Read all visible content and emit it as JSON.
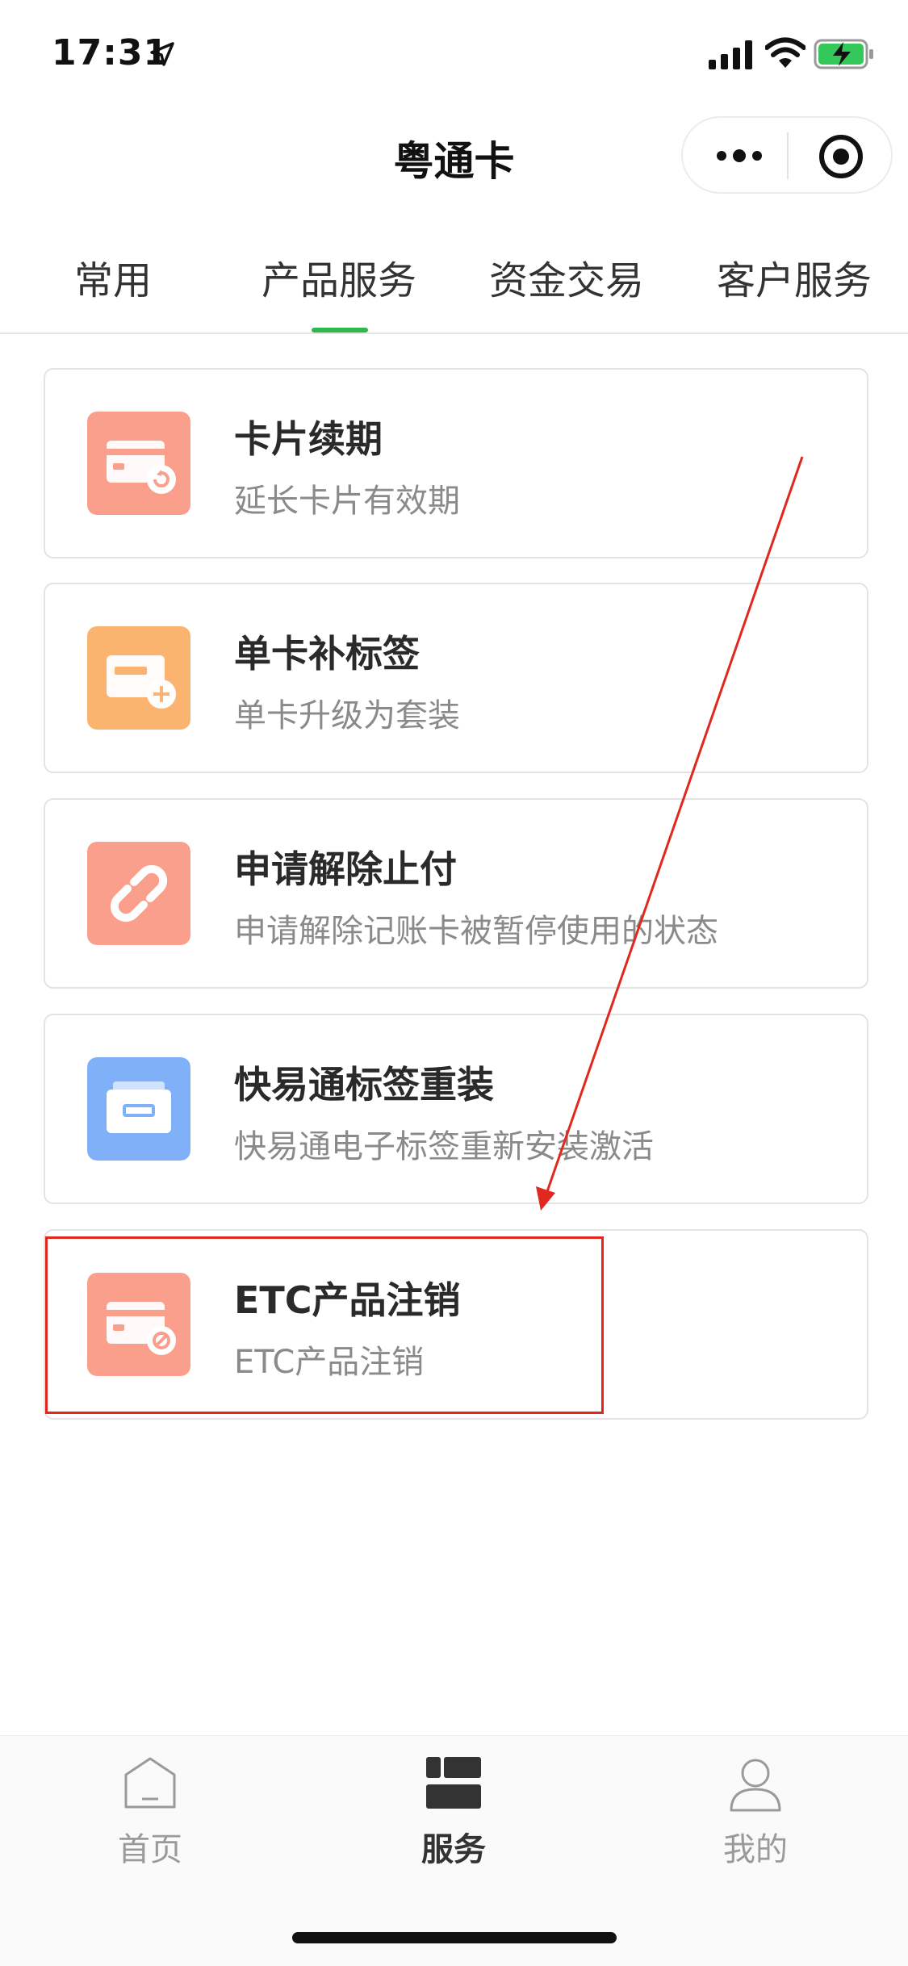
{
  "status_bar": {
    "time": "17:31"
  },
  "nav": {
    "title": "粤通卡"
  },
  "tabs": [
    {
      "label": "常用"
    },
    {
      "label": "产品服务"
    },
    {
      "label": "资金交易"
    },
    {
      "label": "客户服务"
    }
  ],
  "cards": [
    {
      "title": "卡片续期",
      "subtitle": "延长卡片有效期",
      "icon": "card-renew-icon",
      "color": "#f99f8b"
    },
    {
      "title": "单卡补标签",
      "subtitle": "单卡升级为套装",
      "icon": "card-add-icon",
      "color": "#fbb46f"
    },
    {
      "title": "申请解除止付",
      "subtitle": "申请解除记账卡被暂停使用的状态",
      "icon": "unlink-icon",
      "color": "#f99f8b"
    },
    {
      "title": "快易通标签重装",
      "subtitle": "快易通电子标签重新安装激活",
      "icon": "tag-reinstall-icon",
      "color": "#7fb0f8"
    },
    {
      "title": "ETC产品注销",
      "subtitle": "ETC产品注销",
      "icon": "card-cancel-icon",
      "color": "#f99f8b"
    }
  ],
  "bottom_nav": [
    {
      "label": "首页"
    },
    {
      "label": "服务"
    },
    {
      "label": "我的"
    }
  ],
  "colors": {
    "accent": "#2db84d",
    "annotation": "#e0281f"
  }
}
